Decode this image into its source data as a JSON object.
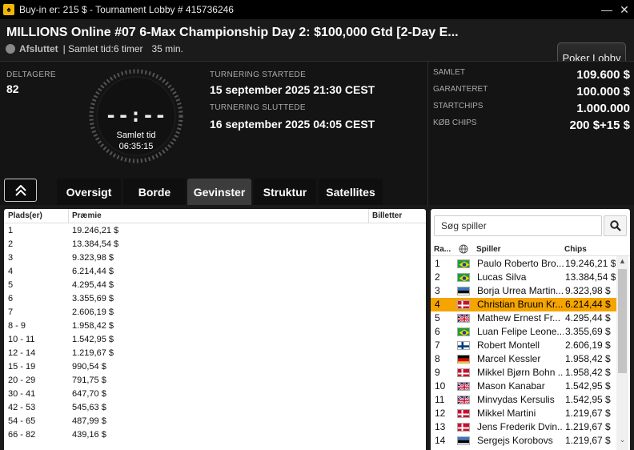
{
  "window": {
    "title": "Buy-in er: 215 $ - Tournament Lobby # 415736246",
    "minimize": "—",
    "close": "✕"
  },
  "header": {
    "title": "MILLIONS Online #07 6-Max Championship Day 2: $100,000 Gtd [2-Day E...",
    "state": "Afsluttet",
    "total_time_label": "| Samlet tid:6 timer",
    "total_time_extra": "35 min.",
    "lobby_button": "Poker Lobby"
  },
  "info": {
    "participants_label": "DELTAGERE",
    "participants_value": "82",
    "clock_display": "--:--",
    "clock_label": "Samlet tid",
    "clock_value": "06:35:15",
    "started_label": "TURNERING STARTEDE",
    "started_value": "15 september 2025  21:30 CEST",
    "ended_label": "TURNERING SLUTTEDE",
    "ended_value": "16 september 2025  04:05 CEST",
    "stats": [
      {
        "key": "SAMLET",
        "value": "109.600 $"
      },
      {
        "key": "GARANTERET",
        "value": "100.000 $"
      },
      {
        "key": "STARTCHIPS",
        "value": "1.000.000"
      },
      {
        "key": "KØB CHIPS",
        "value": "200 $+15 $"
      }
    ]
  },
  "tabs": [
    "Oversigt",
    "Borde",
    "Gevinster",
    "Struktur",
    "Satellites"
  ],
  "active_tab": "Gevinster",
  "prizes": {
    "headers": {
      "place": "Plads(er)",
      "prize": "Præmie",
      "tickets": "Billetter"
    },
    "rows": [
      {
        "place": "1",
        "prize": "19.246,21 $"
      },
      {
        "place": "2",
        "prize": "13.384,54 $"
      },
      {
        "place": "3",
        "prize": "9.323,98 $"
      },
      {
        "place": "4",
        "prize": "6.214,44 $"
      },
      {
        "place": "5",
        "prize": "4.295,44 $"
      },
      {
        "place": "6",
        "prize": "3.355,69 $"
      },
      {
        "place": "7",
        "prize": "2.606,19 $"
      },
      {
        "place": "8 - 9",
        "prize": "1.958,42 $"
      },
      {
        "place": "10 - 11",
        "prize": "1.542,95 $"
      },
      {
        "place": "12 - 14",
        "prize": "1.219,67 $"
      },
      {
        "place": "15 - 19",
        "prize": "990,54 $"
      },
      {
        "place": "20 - 29",
        "prize": "791,75 $"
      },
      {
        "place": "30 - 41",
        "prize": "647,70 $"
      },
      {
        "place": "42 - 53",
        "prize": "545,63 $"
      },
      {
        "place": "54 - 65",
        "prize": "487,99 $"
      },
      {
        "place": "66 - 82",
        "prize": "439,16 $"
      }
    ]
  },
  "players": {
    "search_placeholder": "Søg spiller",
    "headers": {
      "rank": "Ra...",
      "player": "Spiller",
      "chips": "Chips"
    },
    "rows": [
      {
        "rank": "1",
        "flag": "br",
        "name": "Paulo Roberto Bro...",
        "chips": "19.246,21 $"
      },
      {
        "rank": "2",
        "flag": "br",
        "name": "Lucas Silva",
        "chips": "13.384,54 $"
      },
      {
        "rank": "3",
        "flag": "ee",
        "name": "Borja Urrea Martin...",
        "chips": "9.323,98 $"
      },
      {
        "rank": "4",
        "flag": "dk",
        "name": "Christian Bruun Kr...",
        "chips": "6.214,44 $",
        "selected": true
      },
      {
        "rank": "5",
        "flag": "gb",
        "name": "Mathew Ernest Fr...",
        "chips": "4.295,44 $"
      },
      {
        "rank": "6",
        "flag": "br",
        "name": "Luan Felipe Leone...",
        "chips": "3.355,69 $"
      },
      {
        "rank": "7",
        "flag": "fi",
        "name": "Robert Montell",
        "chips": "2.606,19 $"
      },
      {
        "rank": "8",
        "flag": "de",
        "name": "Marcel Kessler",
        "chips": "1.958,42 $"
      },
      {
        "rank": "9",
        "flag": "dk",
        "name": "Mikkel Bjørn Bohn ...",
        "chips": "1.958,42 $"
      },
      {
        "rank": "10",
        "flag": "gb",
        "name": "Mason Kanabar",
        "chips": "1.542,95 $"
      },
      {
        "rank": "11",
        "flag": "gb",
        "name": "Minvydas Kersulis",
        "chips": "1.542,95 $"
      },
      {
        "rank": "12",
        "flag": "dk",
        "name": "Mikkel Martini",
        "chips": "1.219,67 $"
      },
      {
        "rank": "13",
        "flag": "dk",
        "name": "Jens Frederik Dvin...",
        "chips": "1.219,67 $"
      },
      {
        "rank": "14",
        "flag": "ee",
        "name": "Sergejs Korobovs",
        "chips": "1.219,67 $"
      }
    ]
  },
  "colors": {
    "accent": "#f5a400",
    "tab_active": "#3c3c3c",
    "background": "#141414"
  }
}
